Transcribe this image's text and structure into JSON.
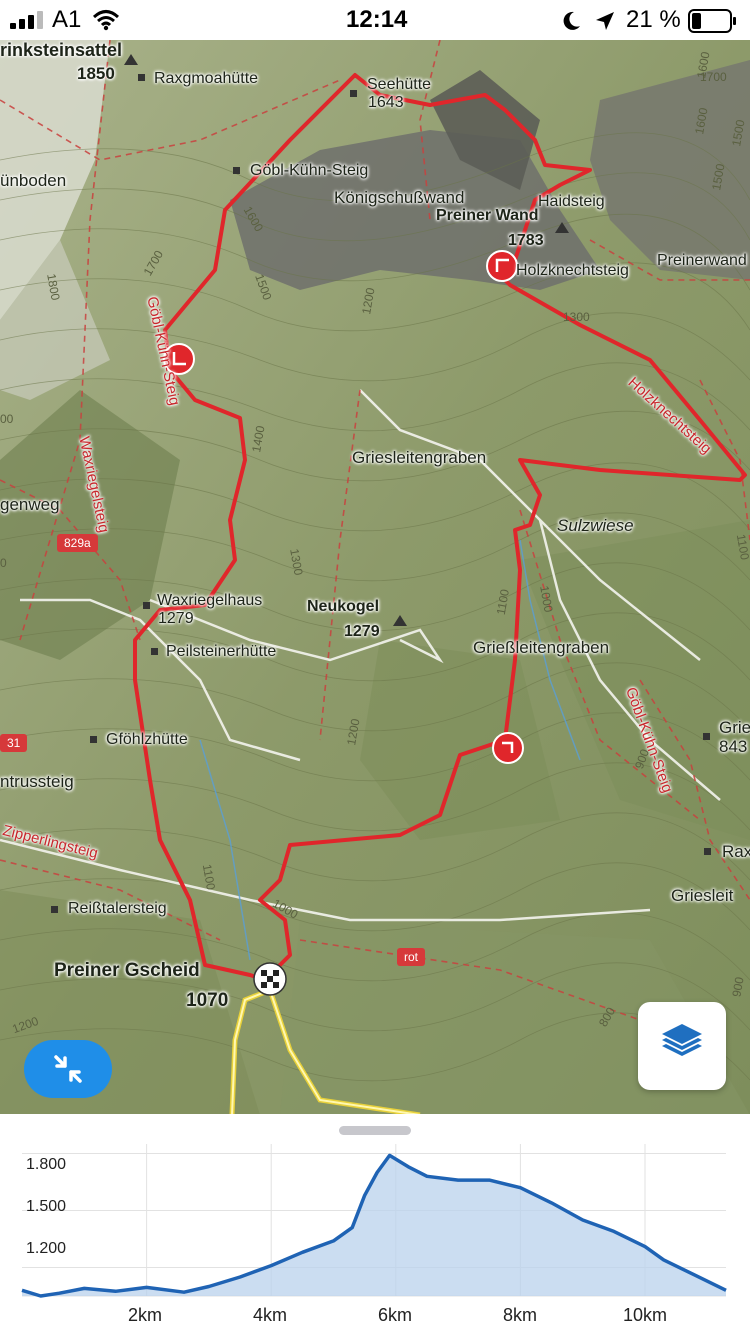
{
  "status_bar": {
    "carrier": "A1",
    "time": "12:14",
    "battery_percent": "21 %"
  },
  "map": {
    "peaks": [
      {
        "name": "rinksteinsattel",
        "elevation": "1850"
      },
      {
        "name": "Seehütte",
        "elevation": "1643"
      },
      {
        "name": "Preiner Wand",
        "elevation": "1783"
      },
      {
        "name": "Waxriegelhaus",
        "elevation": "1279"
      },
      {
        "name": "Neukogel",
        "elevation": "1279"
      },
      {
        "name": "Preiner Gscheid",
        "elevation": "1070"
      }
    ],
    "huts": [
      "Raxgmoahütte",
      "Peilsteinerhütte",
      "Gföhlzhütte",
      "Reißtalersteig"
    ],
    "trails": [
      "Göbl-Kühn-Steig",
      "Holzknechtsteig",
      "Haidsteig",
      "Waxriegelsteig",
      "Holzknechtsteig",
      "Göbl-Kühn-Steig",
      "Zipperlingsteig",
      "Göbl-Kühn-Steig",
      "Preinerwand"
    ],
    "places": [
      "Königschußwand",
      "Griesleitengraben",
      "Grießleitengraben",
      "Sulzwiese",
      "ünboden",
      "genweg",
      "ntrussteig",
      "Gries",
      "843",
      "Rax",
      "Griesleit"
    ],
    "contours": [
      "1800",
      "1700",
      "1600",
      "1500",
      "1600",
      "1500",
      "1400",
      "1300",
      "1200",
      "1300",
      "1100",
      "1000",
      "1200",
      "1100",
      "1000",
      "900",
      "900",
      "800",
      "1200",
      "1700",
      "1600",
      "1500",
      "1100",
      "00",
      "0"
    ],
    "route_badges": [
      "829a",
      "rot",
      "31"
    ],
    "route_color": "#e0262b"
  },
  "buttons": {
    "collapse_icon": "collapse-arrows-icon",
    "layers_icon": "layers-icon"
  },
  "chart_data": {
    "type": "area",
    "title": "",
    "xlabel": "",
    "ylabel": "",
    "x_ticks": [
      "2km",
      "4km",
      "6km",
      "8km",
      "10km"
    ],
    "y_ticks": [
      "1.800",
      "1.500",
      "1.200"
    ],
    "xlim": [
      0,
      11.3
    ],
    "ylim": [
      1050,
      1850
    ],
    "grid": true,
    "line_color": "#1f63b4",
    "fill_color": "#b9d2ec",
    "x": [
      0,
      0.3,
      0.6,
      1.0,
      1.5,
      2.0,
      2.6,
      3.0,
      3.5,
      4.0,
      4.5,
      5.0,
      5.3,
      5.5,
      5.7,
      5.9,
      6.2,
      6.5,
      7.0,
      7.5,
      8.0,
      8.5,
      9.0,
      9.5,
      10.0,
      10.3,
      10.8,
      11.3
    ],
    "y": [
      1080,
      1050,
      1065,
      1090,
      1075,
      1095,
      1070,
      1100,
      1150,
      1210,
      1280,
      1340,
      1410,
      1580,
      1700,
      1790,
      1730,
      1680,
      1660,
      1660,
      1620,
      1540,
      1450,
      1390,
      1310,
      1240,
      1160,
      1080
    ]
  }
}
